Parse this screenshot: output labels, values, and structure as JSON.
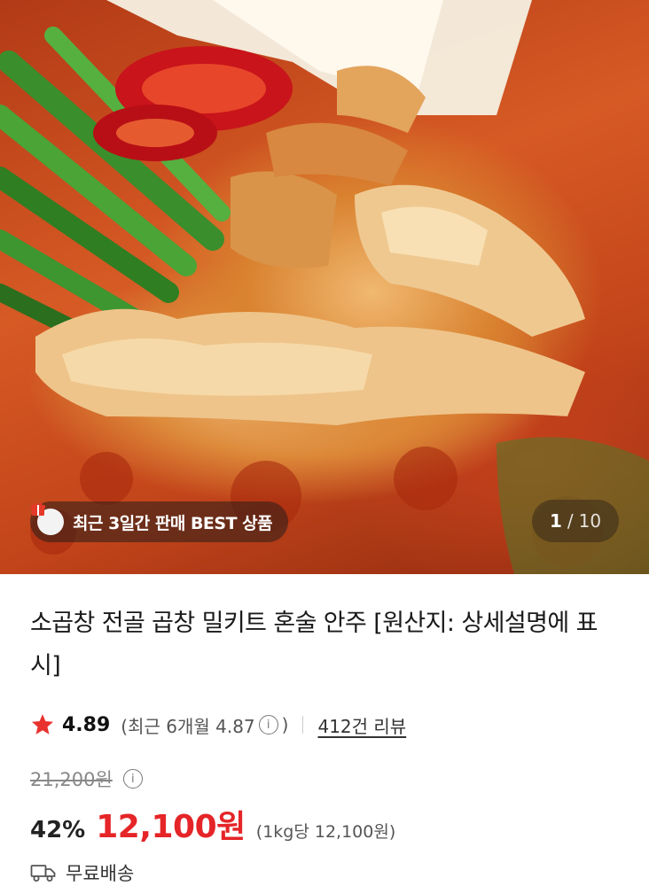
{
  "hero": {
    "badge_text": "최근 3일간 판매 BEST 상품",
    "counter_current": "1",
    "counter_separator": "/",
    "counter_total": "10"
  },
  "product": {
    "title": "소곱창 전골 곱창 밀키트 혼술 안주 [원산지: 상세설명에 표시]"
  },
  "rating": {
    "score": "4.89",
    "recent_label": "(최근 6개월 4.87",
    "recent_close": ")",
    "review_count": "412건 리뷰"
  },
  "price": {
    "original": "21,200원",
    "discount": "42%",
    "sale": "12,100원",
    "unit": "(1kg당 12,100원)"
  },
  "shipping": {
    "label": "무료배송"
  },
  "colors": {
    "sale_red": "#e52528",
    "star_red": "#e8322e"
  }
}
